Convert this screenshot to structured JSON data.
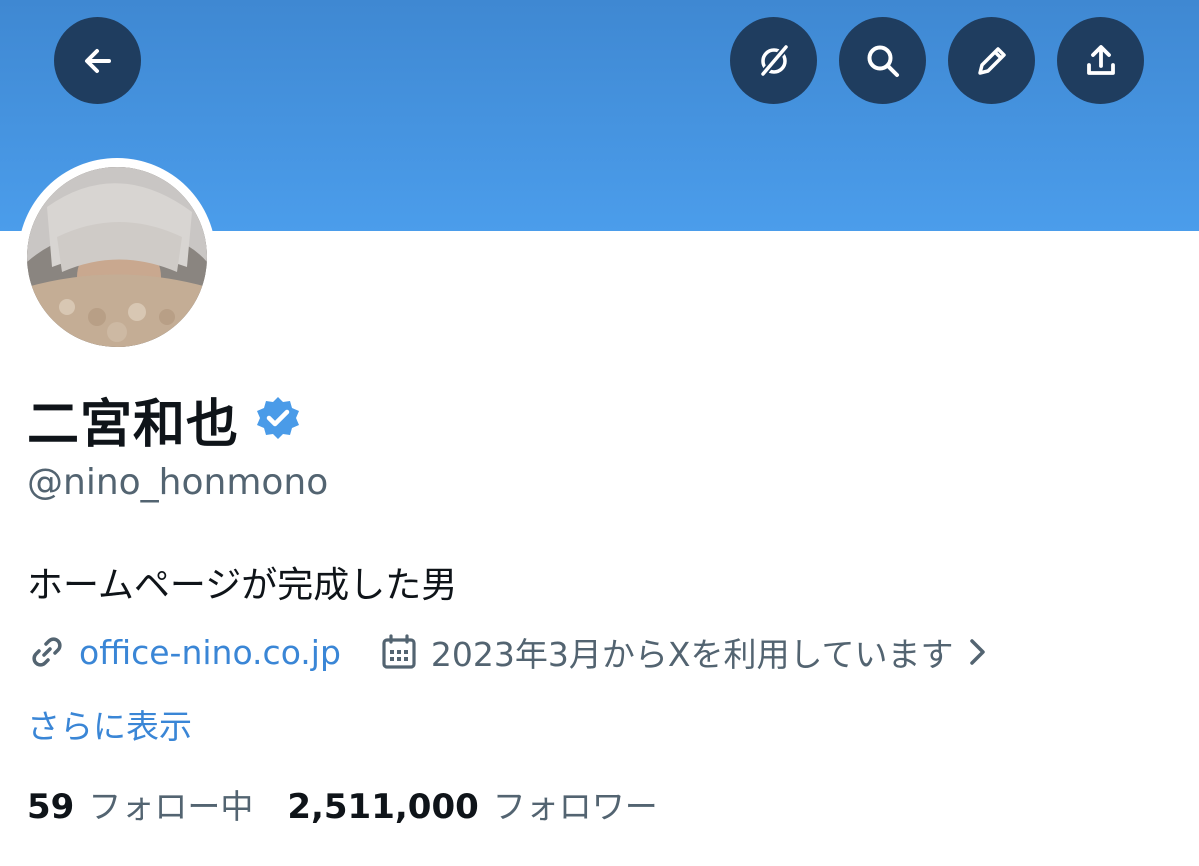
{
  "header": {
    "back_icon": "arrow-left-icon",
    "actions": [
      "grok-icon",
      "search-icon",
      "edit-pencil-icon",
      "share-upload-icon"
    ],
    "banner_color": "#4a9be8",
    "button_color": "#1f3d5f"
  },
  "profile": {
    "display_name": "二宮和也",
    "verified": true,
    "verified_color": "#4a9be8",
    "handle": "@nino_honmono",
    "bio": "ホームページが完成した男",
    "website": "office-nino.co.jp",
    "joined": "2023年3月からXを利用しています",
    "show_more": "さらに表示"
  },
  "stats": {
    "following_count": "59",
    "following_label": "フォロー中",
    "followers_count": "2,511,000",
    "followers_label": "フォロワー"
  }
}
